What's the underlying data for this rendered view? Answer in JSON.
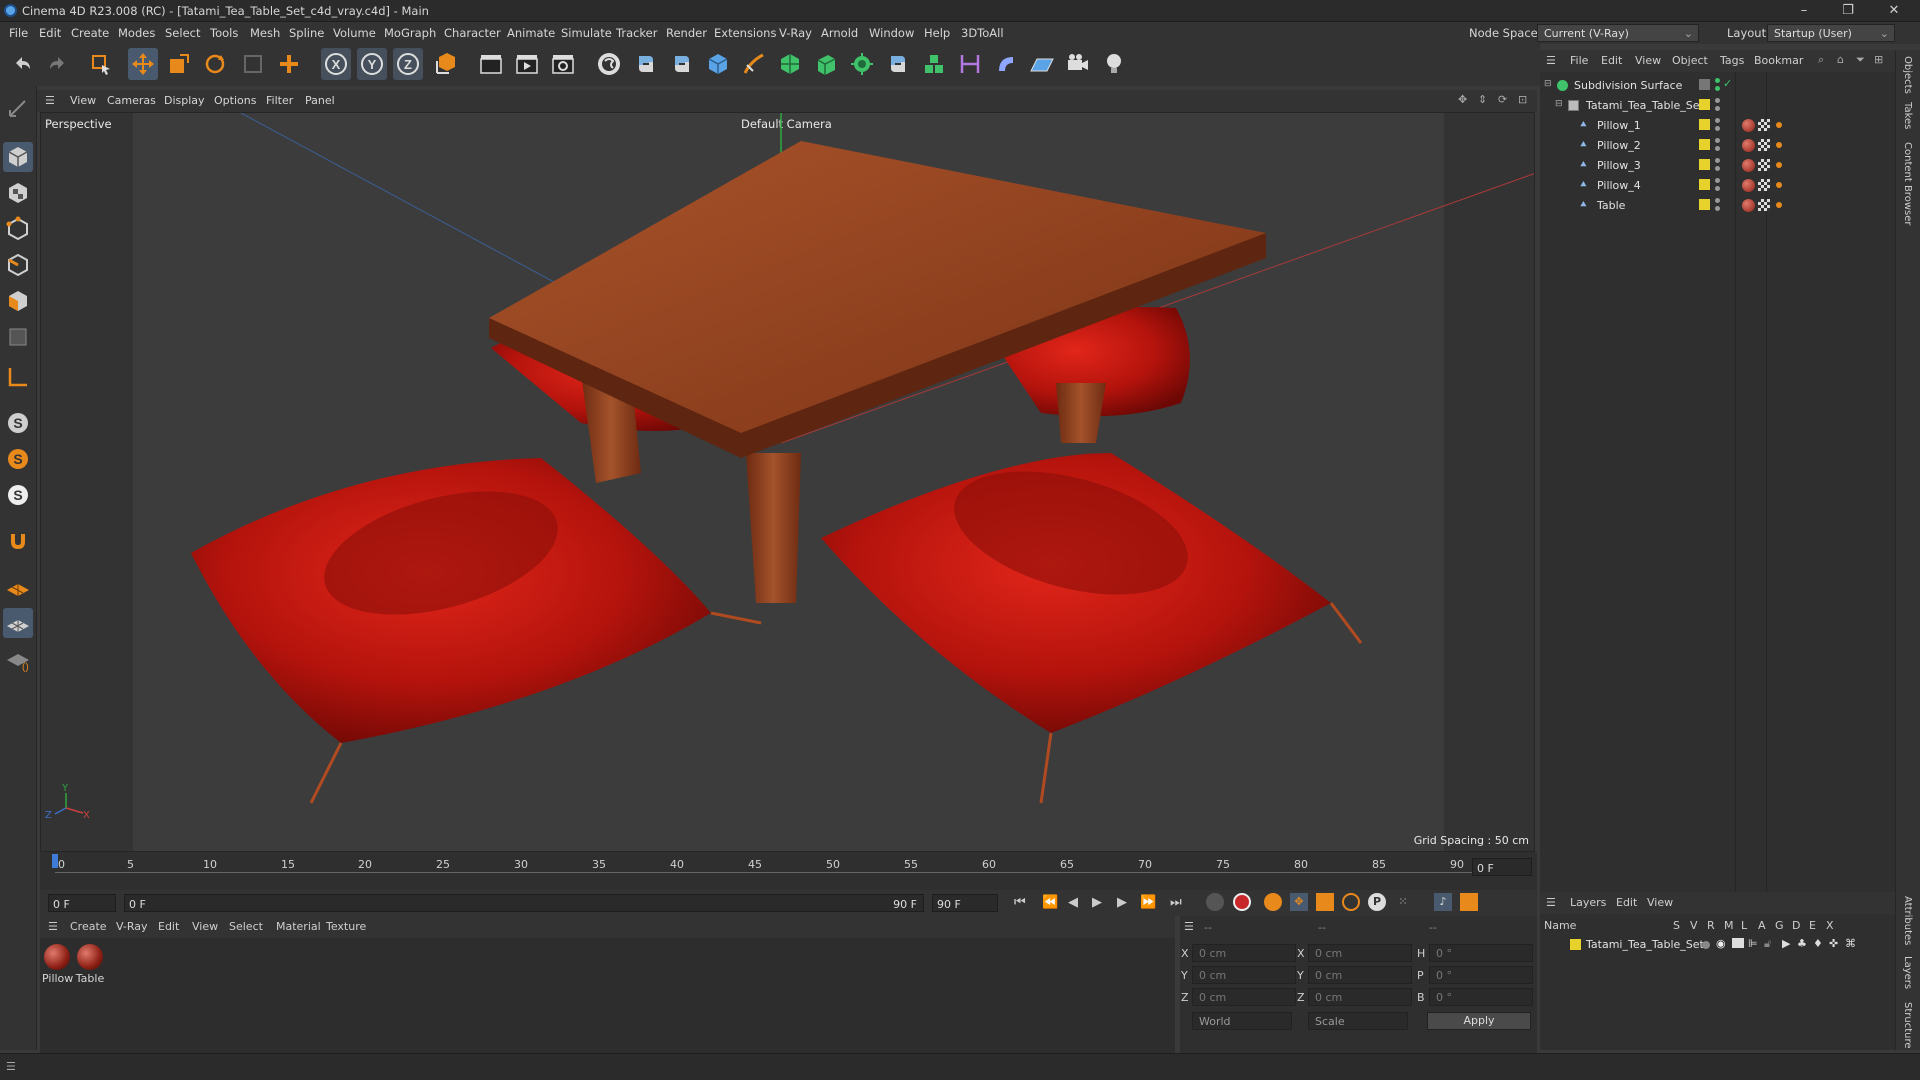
{
  "window": {
    "title": "Cinema 4D R23.008 (RC) - [Tatami_Tea_Table_Set_c4d_vray.c4d] - Main",
    "controls": [
      "–",
      "❐",
      "✕"
    ]
  },
  "menubar": {
    "items": [
      "File",
      "Edit",
      "Create",
      "Modes",
      "Select",
      "Tools",
      "Mesh",
      "Spline",
      "Volume",
      "MoGraph",
      "Character",
      "Animate",
      "Simulate",
      "Tracker",
      "Render",
      "Extensions",
      "V-Ray",
      "Arnold",
      "Window",
      "Help",
      "3DToAll"
    ],
    "node_space_label": "Node Space:",
    "node_space_value": "Current (V-Ray)",
    "layout_label": "Layout:",
    "layout_value": "Startup (User)"
  },
  "viewport": {
    "menu": [
      "View",
      "Cameras",
      "Display",
      "Options",
      "Filter",
      "Panel"
    ],
    "label": "Perspective",
    "camera": "Default Camera",
    "grid_spacing": "Grid Spacing : 50 cm",
    "axis_x": "X",
    "axis_y": "Y",
    "axis_z": "Z"
  },
  "timeline": {
    "ticks": [
      "0",
      "5",
      "10",
      "15",
      "20",
      "25",
      "30",
      "35",
      "40",
      "45",
      "50",
      "55",
      "60",
      "65",
      "70",
      "75",
      "80",
      "85",
      "90"
    ],
    "current_frame": "0 F",
    "start_frame": "0 F",
    "range_start": "0 F",
    "range_end": "90 F",
    "end_frame": "90 F"
  },
  "material_manager": {
    "menu": [
      "Create",
      "V-Ray",
      "Edit",
      "View",
      "Select",
      "Material",
      "Texture"
    ],
    "materials": [
      "Pillow",
      "Table"
    ]
  },
  "coordinates": {
    "header_dashes": [
      "--",
      "--",
      "--"
    ],
    "rows": [
      {
        "pos_label": "X",
        "pos_value": "0 cm",
        "size_label": "X",
        "size_value": "0 cm",
        "rot_label": "H",
        "rot_value": "0 °"
      },
      {
        "pos_label": "Y",
        "pos_value": "0 cm",
        "size_label": "Y",
        "size_value": "0 cm",
        "rot_label": "P",
        "rot_value": "0 °"
      },
      {
        "pos_label": "Z",
        "pos_value": "0 cm",
        "size_label": "Z",
        "size_value": "0 cm",
        "rot_label": "B",
        "rot_value": "0 °"
      }
    ],
    "coord_system": "World",
    "mode": "Scale",
    "apply_label": "Apply"
  },
  "object_manager": {
    "menu": [
      "File",
      "Edit",
      "View",
      "Object",
      "Tags",
      "Bookmar"
    ],
    "objects": [
      {
        "name": "Subdivision Surface",
        "level": 0
      },
      {
        "name": "Tatami_Tea_Table_Set",
        "level": 1
      },
      {
        "name": "Pillow_1",
        "level": 2
      },
      {
        "name": "Pillow_2",
        "level": 2
      },
      {
        "name": "Pillow_3",
        "level": 2
      },
      {
        "name": "Pillow_4",
        "level": 2
      },
      {
        "name": "Table",
        "level": 2
      }
    ]
  },
  "layer_manager": {
    "menu": [
      "Layers",
      "Edit",
      "View"
    ],
    "columns": [
      "Name",
      "S",
      "V",
      "R",
      "M",
      "L",
      "A",
      "G",
      "D",
      "E",
      "X"
    ],
    "layers": [
      "Tatami_Tea_Table_Set"
    ]
  },
  "side_tabs": [
    "Objects",
    "Takes",
    "Content Browser",
    "Attributes",
    "Layers",
    "Structure"
  ],
  "colors": {
    "accent_orange": "#e8891c",
    "layer_yellow": "#e6d22a",
    "pillow_red": "#c4150e",
    "table_brown": "#8a3a1a"
  }
}
